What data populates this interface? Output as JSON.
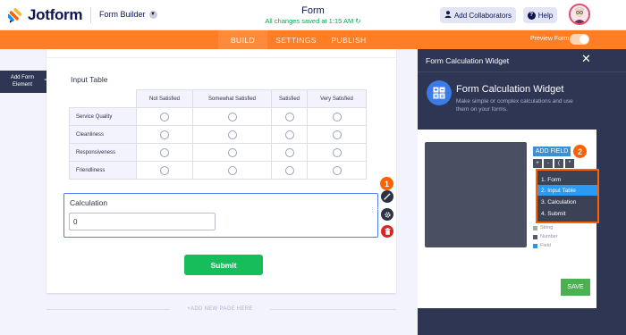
{
  "header": {
    "brand": "Jotform",
    "builder_menu": "Form Builder",
    "form_title": "Form",
    "save_status": "All changes saved at 1:15 AM",
    "collaborators_label": "Add Collaborators",
    "help_label": "Help"
  },
  "tabs": {
    "build": "BUILD",
    "settings": "SETTINGS",
    "publish": "PUBLISH",
    "active": "BUILD"
  },
  "preview": {
    "label": "Preview Form",
    "enabled": false
  },
  "sidebar": {
    "add_element_label": "Add Form Element"
  },
  "form": {
    "matrix_title": "Input Table",
    "columns": [
      "Not Satisfied",
      "Somewhat Satisfied",
      "Satisfied",
      "Very Satisfied"
    ],
    "rows": [
      "Service Quality",
      "Cleanliness",
      "Responsiveness",
      "Friendliness"
    ],
    "calculation_label": "Calculation",
    "calculation_value": "0",
    "submit_label": "Submit",
    "add_page_label": "+ADD NEW PAGE HERE"
  },
  "callouts": {
    "first": "1",
    "second": "2"
  },
  "panel": {
    "title": "Form Calculation Widget",
    "widget_title": "Form Calculation Widget",
    "widget_desc": "Make simple or complex calculations and use them on your forms.",
    "add_field_label": "ADD FIELD",
    "operators": [
      "+",
      "-",
      "(",
      "*"
    ],
    "field_options": [
      "1. Form",
      "2. Input Table",
      "3. Calculation",
      "4. Submit"
    ],
    "selected_option": "2. Input Table",
    "legend": [
      {
        "label": "String",
        "color": "#a8a8a8"
      },
      {
        "label": "Number",
        "color": "#555a6e"
      },
      {
        "label": "Field",
        "color": "#3c8fd0"
      }
    ],
    "save_label": "SAVE"
  },
  "colors": {
    "brand_orange": "#ff7d24",
    "navy": "#2e3654",
    "success_green": "#18bd5b",
    "focus_blue": "#4b7bf5"
  }
}
